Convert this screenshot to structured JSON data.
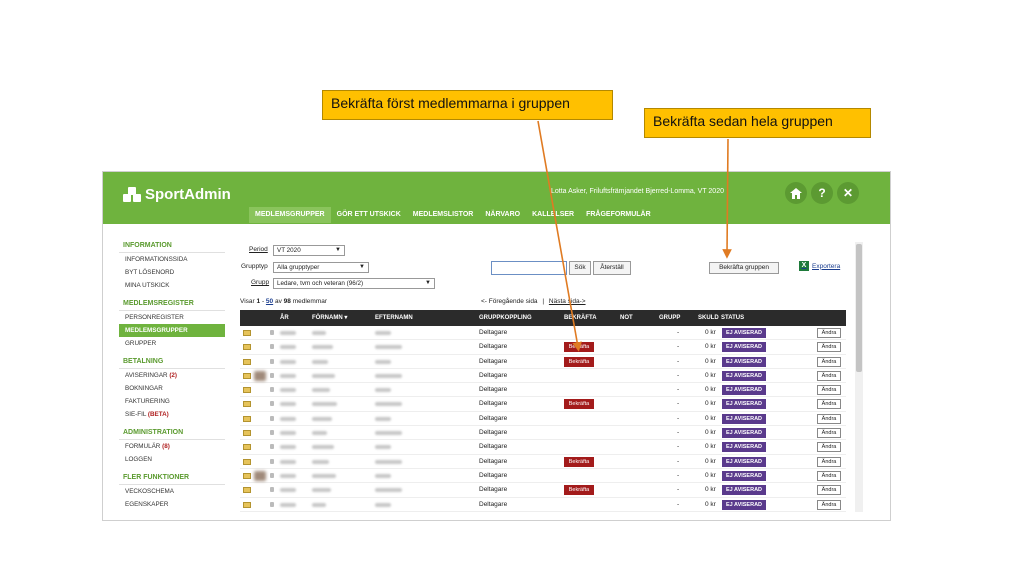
{
  "callouts": {
    "first": "Bekräfta först medlemmarna i gruppen",
    "second": "Bekräfta sedan hela gruppen"
  },
  "header": {
    "logo": "SportAdmin",
    "user_line": "Lotta Asker, Friluftsfrämjandet Bjerred-Lomma, VT 2020",
    "home_icon": "home-icon",
    "help_label": "?",
    "close_label": "✕"
  },
  "nav": {
    "items": [
      "MEDLEMSGRUPPER",
      "GÖR ETT UTSKICK",
      "MEDLEMSLISTOR",
      "NÄRVARO",
      "KALLELSER",
      "FRÅGEFORMULÄR"
    ],
    "active_index": 0
  },
  "sidebar": {
    "sections": [
      {
        "title": "INFORMATION",
        "items": [
          "INFORMATIONSSIDA",
          "BYT LÖSENORD",
          "MINA UTSKICK"
        ]
      },
      {
        "title": "MEDLEMSREGISTER",
        "items": [
          "PERSONREGISTER",
          "MEDLEMSGRUPPER",
          "GRUPPER"
        ]
      },
      {
        "title": "BETALNING",
        "items": [
          "AVISERINGAR",
          "BOKNINGAR",
          "FAKTURERING",
          "SIE-FIL"
        ]
      },
      {
        "title": "ADMINISTRATION",
        "items": [
          "FORMULÄR",
          "LOGGEN"
        ]
      },
      {
        "title": "FLER FUNKTIONER",
        "items": [
          "VECKOSCHEMA",
          "EGENSKAPER"
        ]
      }
    ],
    "aviseringar_count": "(2)",
    "siefil_badge": "(BETA)",
    "formular_count": "(8)"
  },
  "filters": {
    "period_label": "Period",
    "period_value": "VT 2020",
    "grupptyp_label": "Grupptyp",
    "grupptyp_value": "Alla grupptyper",
    "grupp_label": "Grupp",
    "grupp_value": "Ledare, tvm och veteran (96/2)",
    "search_button": "Sök",
    "reset_button": "Återställ",
    "confirm_group_button": "Bekräfta gruppen",
    "export_label": "Exportera"
  },
  "listing": {
    "showing_prefix": "Visar",
    "showing_range_start": "1",
    "showing_range_end": "50",
    "showing_of": "av",
    "total": "98",
    "showing_suffix": "medlemmar",
    "prev": "<- Föregående sida",
    "separator": "|",
    "next": "Nästa sida->"
  },
  "table": {
    "columns": [
      "ÅR",
      "FÖRNAMN ▾",
      "EFTERNAMN",
      "GRUPPKOPPLING",
      "BEKRÄFTA",
      "NOT",
      "GRUPP",
      "SKULD",
      "STATUS"
    ],
    "rows": [
      {
        "koppling": "Deltagare",
        "bekrafta": "",
        "dash": "-",
        "skuld": "0 kr",
        "status": "EJ AVISERAD",
        "action": "Ändra"
      },
      {
        "koppling": "Deltagare",
        "bekrafta": "Bekräfta",
        "dash": "-",
        "skuld": "0 kr",
        "status": "EJ AVISERAD",
        "action": "Ändra"
      },
      {
        "koppling": "Deltagare",
        "bekrafta": "Bekräfta",
        "dash": "-",
        "skuld": "0 kr",
        "status": "EJ AVISERAD",
        "action": "Ändra"
      },
      {
        "koppling": "Deltagare",
        "bekrafta": "",
        "dash": "-",
        "skuld": "0 kr",
        "status": "EJ AVISERAD",
        "action": "Ändra"
      },
      {
        "koppling": "Deltagare",
        "bekrafta": "",
        "dash": "-",
        "skuld": "0 kr",
        "status": "EJ AVISERAD",
        "action": "Ändra"
      },
      {
        "koppling": "Deltagare",
        "bekrafta": "Bekräfta",
        "dash": "-",
        "skuld": "0 kr",
        "status": "EJ AVISERAD",
        "action": "Ändra"
      },
      {
        "koppling": "Deltagare",
        "bekrafta": "",
        "dash": "-",
        "skuld": "0 kr",
        "status": "EJ AVISERAD",
        "action": "Ändra"
      },
      {
        "koppling": "Deltagare",
        "bekrafta": "",
        "dash": "-",
        "skuld": "0 kr",
        "status": "EJ AVISERAD",
        "action": "Ändra"
      },
      {
        "koppling": "Deltagare",
        "bekrafta": "",
        "dash": "-",
        "skuld": "0 kr",
        "status": "EJ AVISERAD",
        "action": "Ändra"
      },
      {
        "koppling": "Deltagare",
        "bekrafta": "Bekräfta",
        "dash": "-",
        "skuld": "0 kr",
        "status": "EJ AVISERAD",
        "action": "Ändra"
      },
      {
        "koppling": "Deltagare",
        "bekrafta": "",
        "dash": "-",
        "skuld": "0 kr",
        "status": "EJ AVISERAD",
        "action": "Ändra"
      },
      {
        "koppling": "Deltagare",
        "bekrafta": "Bekräfta",
        "dash": "-",
        "skuld": "0 kr",
        "status": "EJ AVISERAD",
        "action": "Ändra"
      },
      {
        "koppling": "Deltagare",
        "bekrafta": "",
        "dash": "-",
        "skuld": "0 kr",
        "status": "EJ AVISERAD",
        "action": "Ändra"
      }
    ]
  },
  "colors": {
    "brand_green": "#6fb33e",
    "callout": "#ffc000",
    "arrow": "#e07b22",
    "confirm_red": "#a31b1b",
    "status_purple": "#5a3a8c"
  }
}
